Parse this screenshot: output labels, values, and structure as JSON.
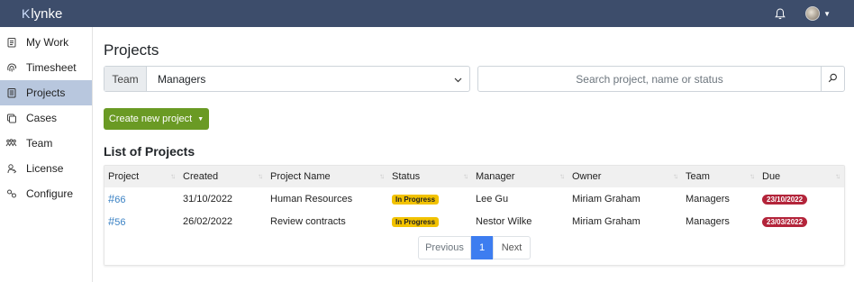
{
  "app": {
    "logo_mark": "K",
    "logo_text": "lynke"
  },
  "sidebar": {
    "items": [
      {
        "label": "My Work",
        "icon": "clipboard-icon"
      },
      {
        "label": "Timesheet",
        "icon": "fingerprint-icon"
      },
      {
        "label": "Projects",
        "icon": "document-icon",
        "active": true
      },
      {
        "label": "Cases",
        "icon": "cases-icon"
      },
      {
        "label": "Team",
        "icon": "team-icon"
      },
      {
        "label": "License",
        "icon": "license-icon"
      },
      {
        "label": "Configure",
        "icon": "configure-icon"
      }
    ]
  },
  "page": {
    "title": "Projects",
    "list_title": "List of Projects"
  },
  "filters": {
    "team_label": "Team",
    "team_value": "Managers",
    "search_placeholder": "Search project, name or status"
  },
  "create_button": "Create new project",
  "table": {
    "headers": [
      "Project",
      "Created",
      "Project Name",
      "Status",
      "Manager",
      "Owner",
      "Team",
      "Due"
    ],
    "rows": [
      {
        "project": "66",
        "created": "31/10/2022",
        "name": "Human Resources",
        "status": "In Progress",
        "manager": "Lee Gu",
        "owner": "Miriam Graham",
        "team": "Managers",
        "due": "23/10/2022"
      },
      {
        "project": "56",
        "created": "26/02/2022",
        "name": "Review contracts",
        "status": "In Progress",
        "manager": "Nestor Wilke",
        "owner": "Miriam Graham",
        "team": "Managers",
        "due": "23/03/2022"
      }
    ]
  },
  "pagination": {
    "prev": "Previous",
    "current": "1",
    "next": "Next"
  },
  "colors": {
    "topbar": "#3d4d6b",
    "create_button": "#6a9a24",
    "status_badge": "#f2c200",
    "due_badge": "#b3243a",
    "active_page": "#3d7df0",
    "sidebar_active": "#b8c7de"
  }
}
